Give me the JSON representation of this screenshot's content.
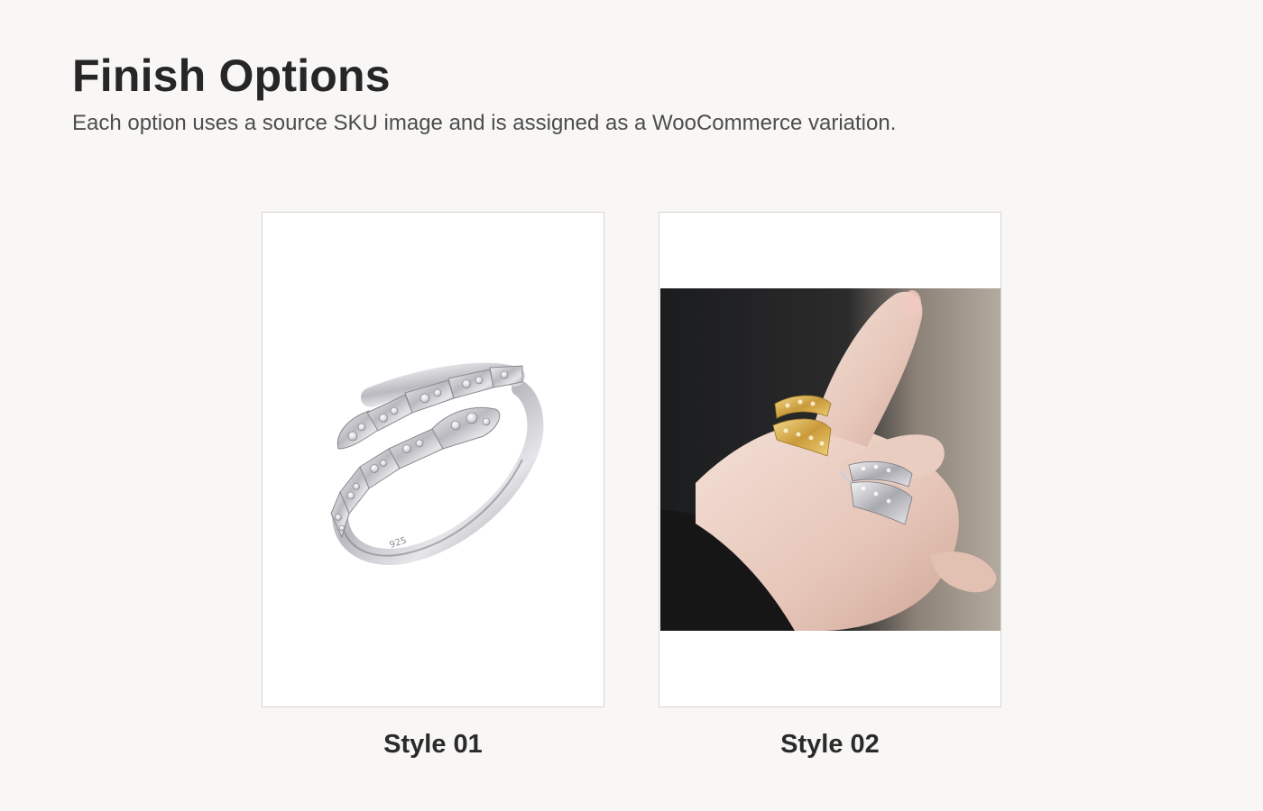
{
  "header": {
    "title": "Finish Options",
    "subtitle": "Each option uses a source SKU image and is assigned as a WooCommerce variation."
  },
  "options": [
    {
      "label": "Style 01",
      "image": "silver-serpent-ring-photo",
      "finish_color": "#c8c8cc"
    },
    {
      "label": "Style 02",
      "image": "hand-wearing-gold-and-silver-serpent-rings-photo",
      "finish_color": "#d4a94a"
    }
  ],
  "colors": {
    "background": "#f8f7f5",
    "card_border": "#d8d6d2",
    "title_text": "#262626",
    "subtitle_text": "#4d4d4d"
  }
}
